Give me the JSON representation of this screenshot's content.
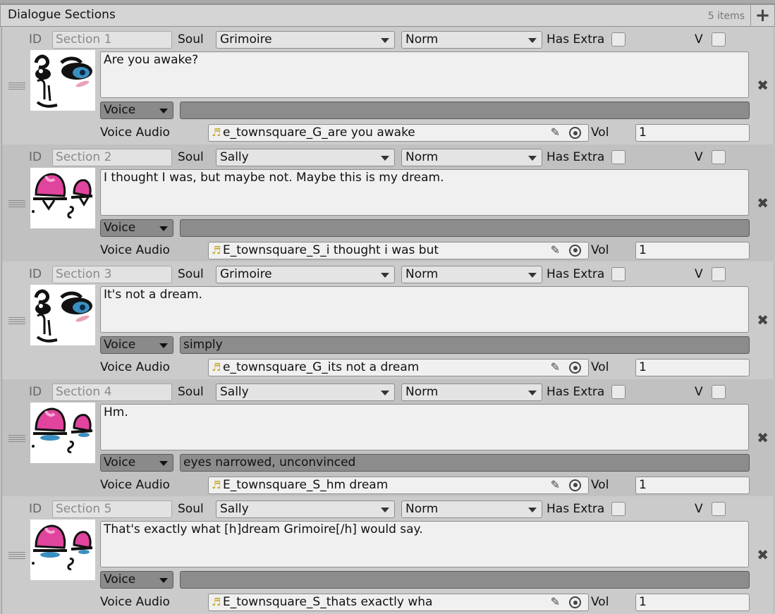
{
  "header": {
    "title": "Dialogue Sections",
    "count": "5 items"
  },
  "labels": {
    "id": "ID",
    "soul": "Soul",
    "has_extra": "Has Extra",
    "v": "V",
    "voice_audio": "Voice Audio",
    "vol": "Vol",
    "voice": "Voice"
  },
  "sections": [
    {
      "id": "Section 1",
      "soul": "Grimoire",
      "mood": "Norm",
      "text": "Are you awake?",
      "voice_note": "",
      "audio": "e_townsquare_G_are you awake",
      "vol": "1",
      "portrait": "grimoire"
    },
    {
      "id": "Section 2",
      "soul": "Sally",
      "mood": "Norm",
      "text": "I thought I was, but maybe not. Maybe this is my dream.",
      "voice_note": "",
      "audio": "E_townsquare_S_i thought i was but",
      "vol": "1",
      "portrait": "sally-wide"
    },
    {
      "id": "Section 3",
      "soul": "Grimoire",
      "mood": "Norm",
      "text": "It's not a dream.",
      "voice_note": "simply",
      "audio": "e_townsquare_G_its not a dream",
      "vol": "1",
      "portrait": "grimoire"
    },
    {
      "id": "Section 4",
      "soul": "Sally",
      "mood": "Norm",
      "text": "Hm.",
      "voice_note": "eyes narrowed, unconvinced",
      "audio": "E_townsquare_S_hm dream",
      "vol": "1",
      "portrait": "sally-narrow"
    },
    {
      "id": "Section 5",
      "soul": "Sally",
      "mood": "Norm",
      "text": "That's exactly what [h]dream Grimoire[/h] would say.",
      "voice_note": "",
      "audio": "E_townsquare_S_thats exactly wha",
      "vol": "1",
      "portrait": "sally-narrow"
    }
  ]
}
